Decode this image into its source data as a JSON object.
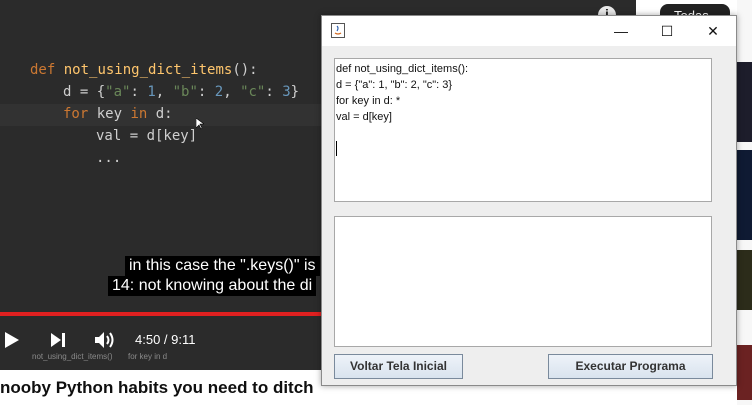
{
  "video": {
    "code": {
      "line1_kw": "def",
      "line1_fn": "not_using_dict_items",
      "line1_rest": "():",
      "line2_a": "d = {",
      "line2_s1": "\"a\"",
      "line2_b": ": ",
      "line2_n1": "1",
      "line2_c": ", ",
      "line2_s2": "\"b\"",
      "line2_d": ": ",
      "line2_n2": "2",
      "line2_e": ", ",
      "line2_s3": "\"c\"",
      "line2_f": ": ",
      "line2_n3": "3",
      "line2_g": "}",
      "line3_kw1": "for",
      "line3_a": " key ",
      "line3_kw2": "in",
      "line3_b": " d:",
      "line4": "val = d[key]",
      "line5": "..."
    },
    "caption_line1": "in this case the \".keys()\" is",
    "caption_line2": "14: not knowing about the di",
    "time": "4:50 / 9:11",
    "progress": 0.53,
    "chapter_left": "not_using_dict_items()",
    "chapter_right": "for key in d",
    "title": "nooby Python habits you need to ditch",
    "chip_label": "Todas"
  },
  "window": {
    "minimize_glyph": "—",
    "maximize_glyph": "☐",
    "close_glyph": "✕",
    "code_lines": [
      "def not_using_dict_items():",
      "d = {\"a\": 1, \"b\": 2, \"c\": 3}",
      "for key in d: *",
      "val = d[key]"
    ],
    "output_text": "",
    "back_button": "Voltar Tela Inicial",
    "run_button": "Executar Programa"
  },
  "colors": {
    "video_bg": "#2b2b2b",
    "progress": "#e02020",
    "keyword": "#cc7832",
    "function": "#ffc66d",
    "string": "#6a8759",
    "number": "#6897bb"
  }
}
